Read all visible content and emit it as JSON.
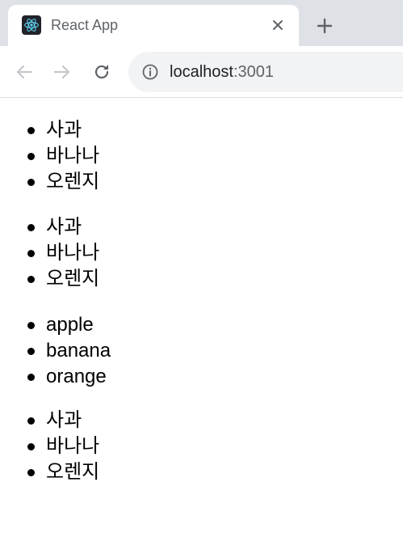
{
  "browser": {
    "tab_title": "React App",
    "url_host": "localhost",
    "url_port": ":3001",
    "icons": {
      "favicon": "react-logo-icon",
      "close": "close-icon",
      "new_tab": "plus-icon",
      "back": "arrow-left-icon",
      "forward": "arrow-right-icon",
      "reload": "reload-icon",
      "site_info": "info-icon"
    }
  },
  "lists": [
    {
      "items": [
        "사과",
        "바나나",
        "오렌지"
      ]
    },
    {
      "items": [
        "사과",
        "바나나",
        "오렌지"
      ]
    },
    {
      "items": [
        "apple",
        "banana",
        "orange"
      ]
    },
    {
      "items": [
        "사과",
        "바나나",
        "오렌지"
      ]
    }
  ]
}
